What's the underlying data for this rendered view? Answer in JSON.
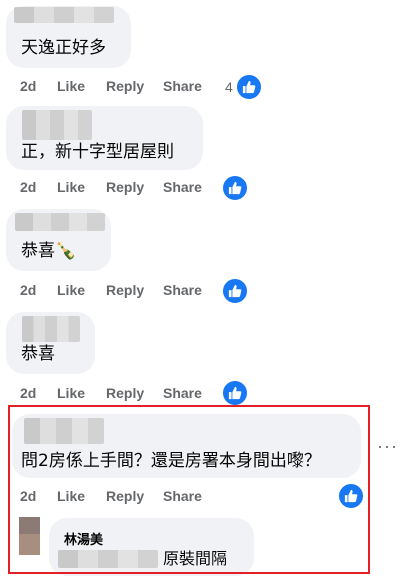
{
  "comments": [
    {
      "text": "天逸正好多",
      "time": "2d",
      "like": "Like",
      "reply": "Reply",
      "share": "Share",
      "reactions": "4"
    },
    {
      "text": "正，新十字型居屋則",
      "time": "2d",
      "like": "Like",
      "reply": "Reply",
      "share": "Share",
      "reactions": ""
    },
    {
      "text": "恭喜🍾",
      "time": "2d",
      "like": "Like",
      "reply": "Reply",
      "share": "Share",
      "reactions": ""
    },
    {
      "text": "恭喜",
      "time": "2d",
      "like": "Like",
      "reply": "Reply",
      "share": "Share",
      "reactions": ""
    },
    {
      "text": "問2房係上手間？還是房署本身間出嚟？",
      "time": "2d",
      "like": "Like",
      "reply": "Reply",
      "share": "Share",
      "reactions": ""
    }
  ],
  "reply": {
    "author": "林湯美",
    "text": "原裝間隔"
  },
  "more_label": "···",
  "colors": {
    "accent": "#1877f2",
    "highlight": "#e32026",
    "bubble": "#f0f2f5"
  },
  "icons": {
    "reaction": "thumbs-up-icon",
    "more": "more-options-icon"
  }
}
